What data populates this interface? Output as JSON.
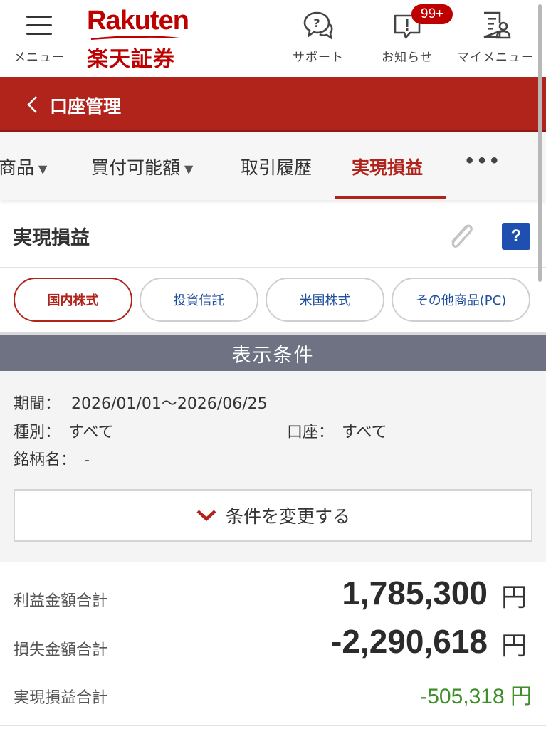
{
  "header": {
    "menu_label": "メニュー",
    "logo_en": "Rakuten",
    "logo_jp": "楽天証券",
    "support_label": "サポート",
    "notice_label": "お知らせ",
    "notice_badge": "99+",
    "mymenu_label": "マイメニュー",
    "brand_color": "#bf0000"
  },
  "titlebar": {
    "back_icon": "chevron-left-icon",
    "title": "口座管理"
  },
  "tabs": [
    {
      "label": "商品",
      "has_caret": true
    },
    {
      "label": "買付可能額",
      "has_caret": true
    },
    {
      "label": "取引履歴",
      "has_caret": false
    },
    {
      "label": "実現損益",
      "active": true
    },
    {
      "label": "•••"
    }
  ],
  "section": {
    "title": "実現損益",
    "help_label": "?"
  },
  "product_pills": [
    {
      "label": "国内株式",
      "active": true
    },
    {
      "label": "投資信託"
    },
    {
      "label": "米国株式"
    },
    {
      "label": "その他商品(PC)"
    }
  ],
  "conditions": {
    "header": "表示条件",
    "period_label": "期間：",
    "period_value": "2026/01/01〜2026/06/25",
    "type_label": "種別：",
    "type_value": "すべて",
    "account_label": "口座：",
    "account_value": "すべて",
    "name_label": "銘柄名：",
    "name_value": "-",
    "change_button": "条件を変更する"
  },
  "totals": {
    "profit_label": "利益金額合計",
    "profit_value": "1,785,300",
    "loss_label": "損失金額合計",
    "loss_value": "-2,290,618",
    "unit": "円",
    "net_label": "実現損益合計",
    "net_value": "-505,318 円",
    "net_color": "#3e8e2a",
    "accent_color": "#b0241b"
  }
}
